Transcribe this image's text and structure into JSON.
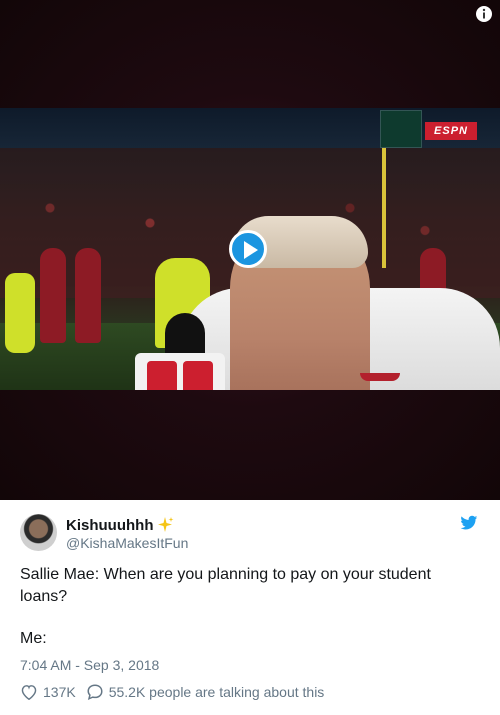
{
  "media": {
    "broadcaster": "ESPN",
    "play_button_color": "#1b95e0"
  },
  "tweet": {
    "display_name": "Kishuuuhhh",
    "handle": "@KishaMakesItFun",
    "text": "Sallie Mae: When are you planning to pay on your student loans?",
    "text_line2": "Me:",
    "timestamp": "7:04 AM - Sep 3, 2018",
    "likes": "137K",
    "replies_text": "55.2K people are talking about this",
    "brand_color": "#1da1f2",
    "sparkle_color": "#f5c518"
  },
  "icons": [
    "info-icon",
    "play-icon",
    "sparkles-icon",
    "twitter-bird-icon",
    "heart-icon",
    "reply-bubble-icon"
  ]
}
